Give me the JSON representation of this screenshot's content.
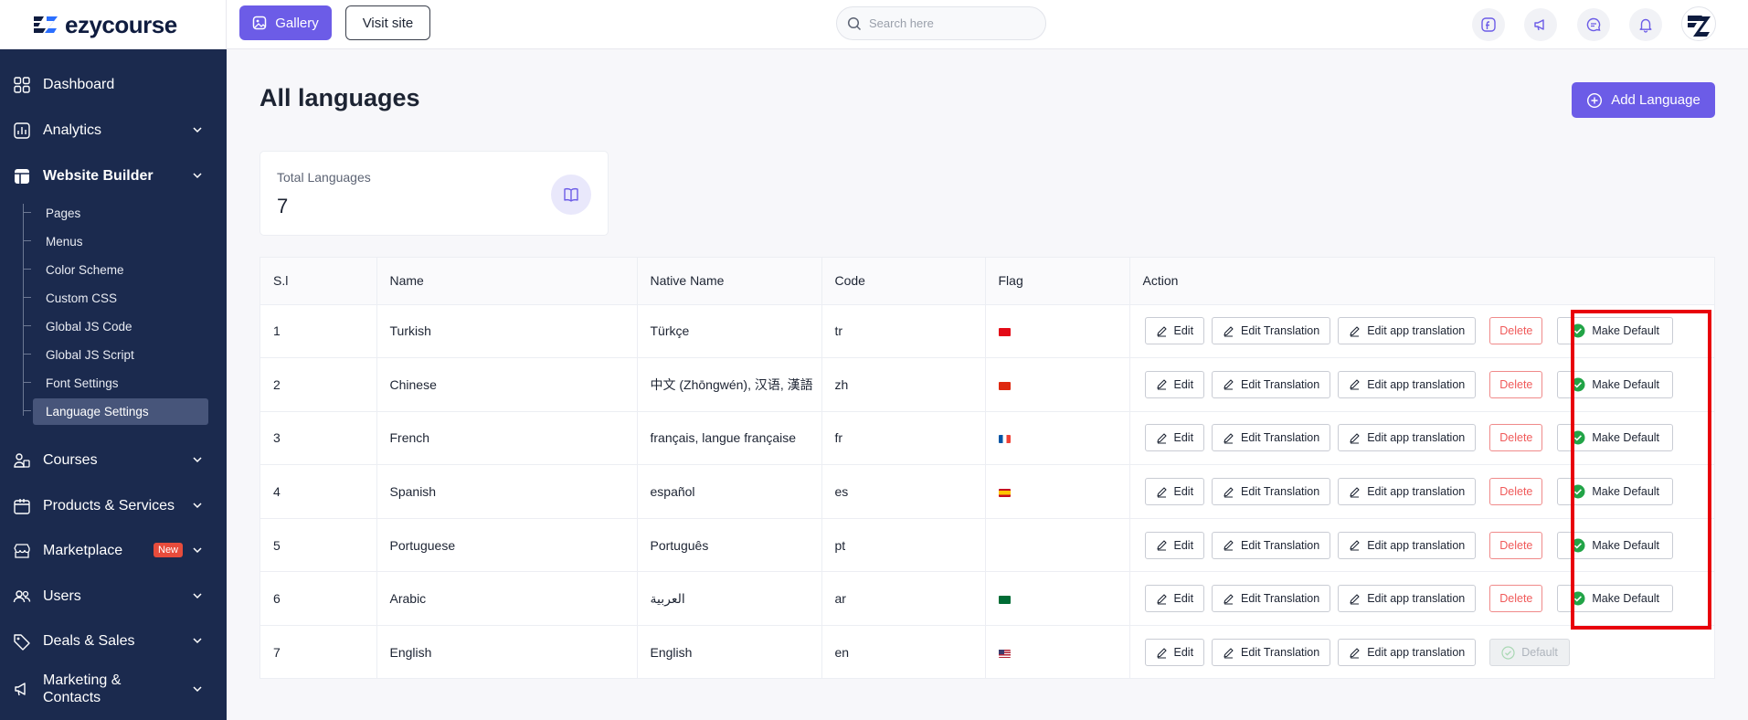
{
  "brand": {
    "name": "ezycourse"
  },
  "topbar": {
    "gallery_label": "Gallery",
    "visit_label": "Visit site",
    "search_placeholder": "Search here"
  },
  "sidebar": {
    "items": [
      {
        "label": "Dashboard",
        "icon": "grid-icon"
      },
      {
        "label": "Analytics",
        "icon": "chart-icon"
      },
      {
        "label": "Website Builder",
        "icon": "builder-icon"
      },
      {
        "label": "Courses",
        "icon": "courses-icon"
      },
      {
        "label": "Products & Services",
        "icon": "box-icon"
      },
      {
        "label": "Marketplace",
        "icon": "store-icon",
        "badge": "New"
      },
      {
        "label": "Users",
        "icon": "users-icon"
      },
      {
        "label": "Deals & Sales",
        "icon": "tag-icon"
      },
      {
        "label": "Marketing & Contacts",
        "icon": "megaphone-icon"
      }
    ],
    "sub_items": [
      "Pages",
      "Menus",
      "Color Scheme",
      "Custom CSS",
      "Global JS Code",
      "Global JS Script",
      "Font Settings",
      "Language Settings"
    ]
  },
  "main": {
    "title": "All languages",
    "add_label": "Add Language",
    "stat": {
      "label": "Total Languages",
      "value": "7"
    },
    "table": {
      "headers": [
        "S.l",
        "Name",
        "Native Name",
        "Code",
        "Flag",
        "Action"
      ],
      "rows": [
        {
          "sl": "1",
          "name": "Turkish",
          "native": "Türkçe",
          "code": "tr",
          "flag": "tr"
        },
        {
          "sl": "2",
          "name": "Chinese",
          "native": "中文 (Zhōngwén), 汉语, 漢語",
          "code": "zh",
          "flag": "zh"
        },
        {
          "sl": "3",
          "name": "French",
          "native": "français, langue française",
          "code": "fr",
          "flag": "fr"
        },
        {
          "sl": "4",
          "name": "Spanish",
          "native": "español",
          "code": "es",
          "flag": "es"
        },
        {
          "sl": "5",
          "name": "Portuguese",
          "native": "Português",
          "code": "pt",
          "flag": ""
        },
        {
          "sl": "6",
          "name": "Arabic",
          "native": "العربية",
          "code": "ar",
          "flag": "ar"
        },
        {
          "sl": "7",
          "name": "English",
          "native": "English",
          "code": "en",
          "flag": "en"
        }
      ],
      "action_labels": {
        "edit": "Edit",
        "edit_translation": "Edit Translation",
        "edit_app_translation": "Edit app translation",
        "delete": "Delete",
        "make_default": "Make Default",
        "default": "Default"
      }
    }
  },
  "colors": {
    "accent": "#6c5ce7",
    "sidebar": "#1b2a4e",
    "danger": "#f05a5a",
    "success": "#22a447",
    "highlight": "#e8000b"
  }
}
